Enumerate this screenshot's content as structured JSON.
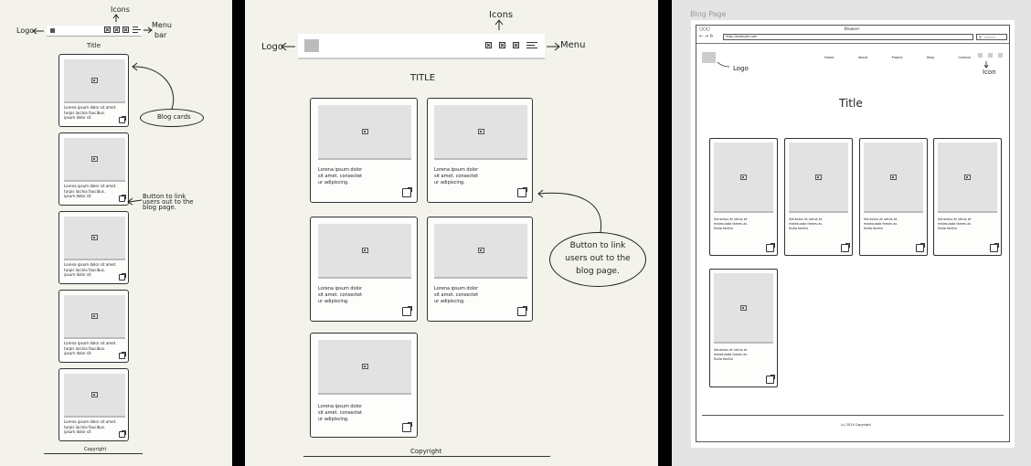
{
  "mobile": {
    "icons_label": "Icons",
    "logo_label": "Logo",
    "menu_label": "Menu",
    "menu_label2": "bar",
    "title": "Title",
    "blog_cards_label": "Blog cards",
    "button_note": "Button to link\nusers out to the\nblog page.",
    "card_text": "Lorena ipsum dolor sit amet.\nturpis lacinia faucibus.\nipsum dolor sit",
    "copyright": "Copyright"
  },
  "tablet": {
    "icons_label": "Icons",
    "logo_label": "Logo",
    "menu_label": "Menu",
    "title": "TITLE",
    "card_text": "Lorena ipsum dolor\nsit amet. consectet\nur adipiscing.",
    "button_note": "Button to link\nusers out to the\nblog page.",
    "copyright": "Copyright"
  },
  "desktop": {
    "caption": "Blog Page",
    "browser_title": "Browser",
    "url": "http://example.com",
    "search_placeholder": "Search",
    "logo_label": "Logo",
    "icon_label": "Icon",
    "nav": [
      "Home",
      "About",
      "Project",
      "Blog",
      "Contact"
    ],
    "title": "Title",
    "card_text": "Senectus et netus et\nmalesuada fames ac.\nNulla facilisi",
    "copyright": "(c) 2024 Copyright"
  }
}
